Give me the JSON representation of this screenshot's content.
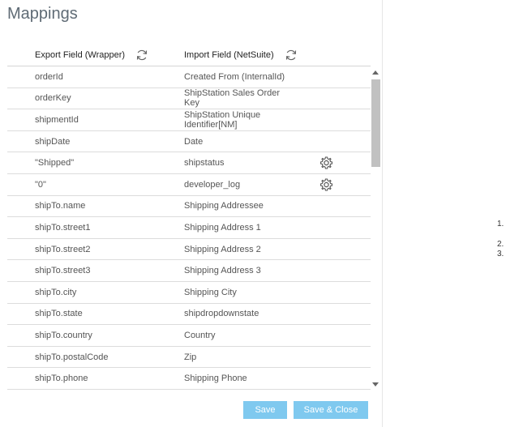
{
  "title": "Mappings",
  "headers": {
    "export": "Export Field (Wrapper)",
    "import": "Import Field (NetSuite)"
  },
  "rows": [
    {
      "export": "orderId",
      "import": "Created From (InternalId)",
      "gear": false
    },
    {
      "export": "orderKey",
      "import": "ShipStation Sales Order Key",
      "gear": false
    },
    {
      "export": "shipmentId",
      "import": "ShipStation Unique Identifier[NM]",
      "gear": false
    },
    {
      "export": "shipDate",
      "import": "Date",
      "gear": false
    },
    {
      "export": "\"Shipped\"",
      "import": "shipstatus",
      "gear": true
    },
    {
      "export": "\"0\"",
      "import": "developer_log",
      "gear": true
    },
    {
      "export": "shipTo.name",
      "import": "Shipping Addressee",
      "gear": false
    },
    {
      "export": "shipTo.street1",
      "import": "Shipping Address 1",
      "gear": false
    },
    {
      "export": "shipTo.street2",
      "import": "Shipping Address 2",
      "gear": false
    },
    {
      "export": "shipTo.street3",
      "import": "Shipping Address 3",
      "gear": false
    },
    {
      "export": "shipTo.city",
      "import": "Shipping City",
      "gear": false
    },
    {
      "export": "shipTo.state",
      "import": "shipdropdownstate",
      "gear": false
    },
    {
      "export": "shipTo.country",
      "import": "Country",
      "gear": false
    },
    {
      "export": "shipTo.postalCode",
      "import": "Zip",
      "gear": false
    },
    {
      "export": "shipTo.phone",
      "import": "Shipping Phone",
      "gear": false
    }
  ],
  "buttons": {
    "save": "Save",
    "save_close": "Save & Close"
  },
  "side_list": [
    "1.",
    "2.",
    "3."
  ],
  "icons": {
    "refresh": "refresh-icon",
    "gear": "gear-icon"
  },
  "colors": {
    "button": "#7fc9ef",
    "title": "#5f6b75"
  }
}
